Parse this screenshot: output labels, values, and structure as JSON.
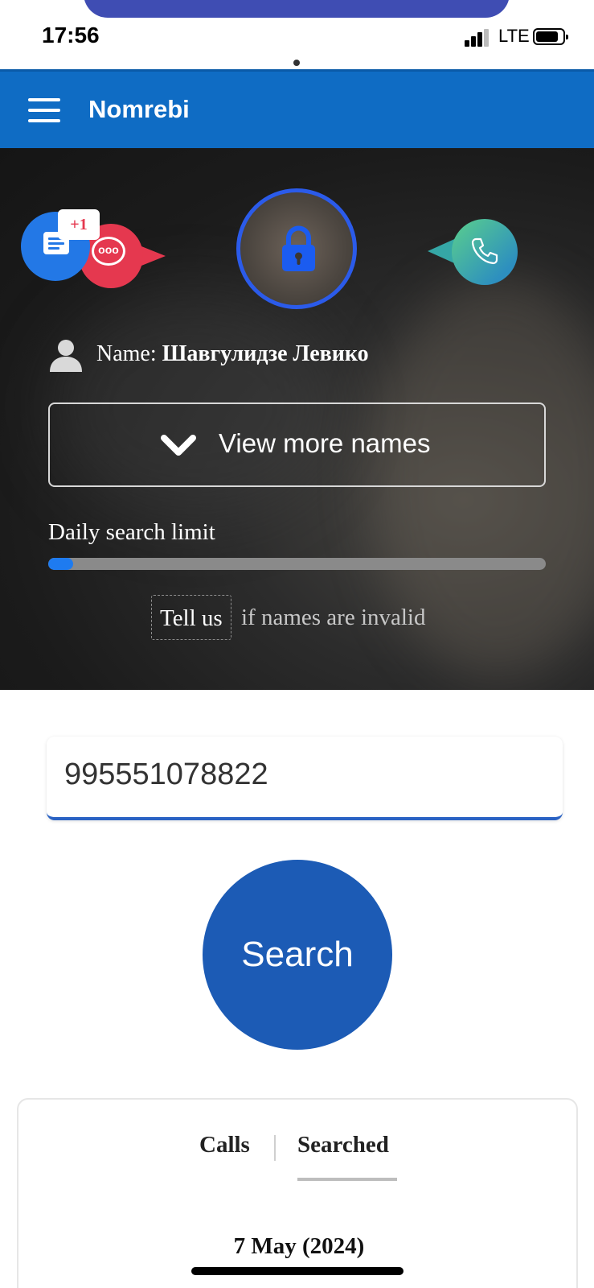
{
  "status_bar": {
    "time": "17:56",
    "network": "LTE",
    "signal_bars": 3,
    "battery_level": 0.85
  },
  "header": {
    "title": "Nomrebi",
    "menu_icon": "hamburger-menu-icon",
    "background_color": "#0f6cc4"
  },
  "hero": {
    "icons": {
      "left": "message-bubbles-icon",
      "center": "lock-icon",
      "right": "phone-icon"
    },
    "badge": "+1",
    "chat_dots": "ooo",
    "name_label": "Name: ",
    "name_value": "Шавгулидзе Левико",
    "view_more_label": "View more names",
    "daily_limit_label": "Daily search limit",
    "daily_limit_progress": 0.05,
    "tell_us_label": "Tell us",
    "tell_us_suffix": "if names are invalid"
  },
  "search": {
    "phone_value": "995551078822",
    "button_label": "Search",
    "accent_color": "#1c5bb5"
  },
  "history": {
    "tabs": [
      {
        "label": "Calls",
        "active": false
      },
      {
        "label": "Searched",
        "active": true
      }
    ],
    "date_label": "7 May (2024)"
  }
}
